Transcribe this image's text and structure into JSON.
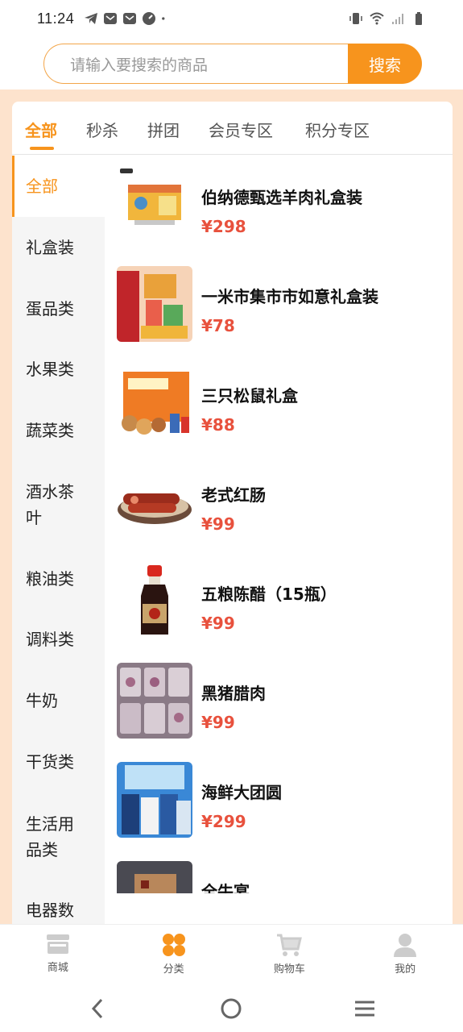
{
  "status_bar": {
    "time": "11:24"
  },
  "search": {
    "placeholder": "请输入要搜索的商品",
    "button_label": "搜索"
  },
  "tabs": [
    {
      "label": "全部",
      "active": true
    },
    {
      "label": "秒杀"
    },
    {
      "label": "拼团"
    },
    {
      "label": "会员专区"
    },
    {
      "label": "积分专区"
    }
  ],
  "sidebar": {
    "items": [
      {
        "label": "全部",
        "active": true
      },
      {
        "label": "礼盒装"
      },
      {
        "label": "蛋品类"
      },
      {
        "label": "水果类"
      },
      {
        "label": "蔬菜类"
      },
      {
        "label": "酒水茶叶"
      },
      {
        "label": "粮油类"
      },
      {
        "label": "调料类"
      },
      {
        "label": "牛奶"
      },
      {
        "label": "干货类"
      },
      {
        "label": "生活用品类"
      },
      {
        "label": "电器数"
      }
    ]
  },
  "products": [
    {
      "name": "伯纳德甄选羊肉礼盒装",
      "price": "¥298"
    },
    {
      "name": "一米市集市市如意礼盒装",
      "price": "¥78"
    },
    {
      "name": "三只松鼠礼盒",
      "price": "¥88"
    },
    {
      "name": "老式红肠",
      "price": "¥99"
    },
    {
      "name": "五粮陈醋（15瓶）",
      "price": "¥99"
    },
    {
      "name": "黑猪腊肉",
      "price": "¥99"
    },
    {
      "name": "海鲜大团圆",
      "price": "¥299"
    },
    {
      "name": "全牛宴",
      "price": ""
    }
  ],
  "bottom_nav": [
    {
      "label": "商城",
      "icon": "store-icon"
    },
    {
      "label": "分类",
      "icon": "category-icon",
      "active": true
    },
    {
      "label": "购物车",
      "icon": "cart-icon"
    },
    {
      "label": "我的",
      "icon": "user-icon"
    }
  ],
  "colors": {
    "accent": "#f7941d",
    "price": "#e8513d",
    "peach_bg": "#fde3cd"
  }
}
